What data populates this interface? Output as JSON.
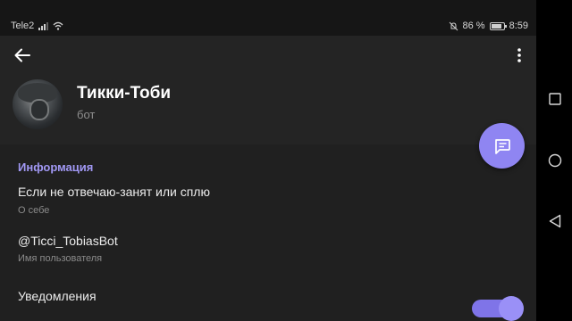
{
  "status_bar": {
    "carrier": "Tele2",
    "battery_percent": "86 %",
    "time": "8:59",
    "icons": [
      "signal-icon",
      "wifi-icon",
      "mute-icon",
      "battery-icon"
    ]
  },
  "header": {
    "back_icon": "arrow-left-icon",
    "menu_icon": "more-vertical-icon",
    "name": "Тикки-Тоби",
    "subtitle": "бот"
  },
  "fab": {
    "icon": "message-icon",
    "color": "#8f85f2"
  },
  "info": {
    "section_title": "Информация",
    "about_value": "Если не отвечаю-занят или сплю",
    "about_caption": "О себе",
    "username_value": "@Ticci_TobiasBot",
    "username_caption": "Имя пользователя",
    "notifications_label": "Уведомления",
    "notifications_enabled": true
  },
  "nav": {
    "icons": [
      "recents-square-icon",
      "home-circle-icon",
      "back-triangle-icon"
    ]
  },
  "colors": {
    "accent": "#8f85f2",
    "section_title": "#a198f4",
    "background": "#202020",
    "header": "#242424"
  }
}
